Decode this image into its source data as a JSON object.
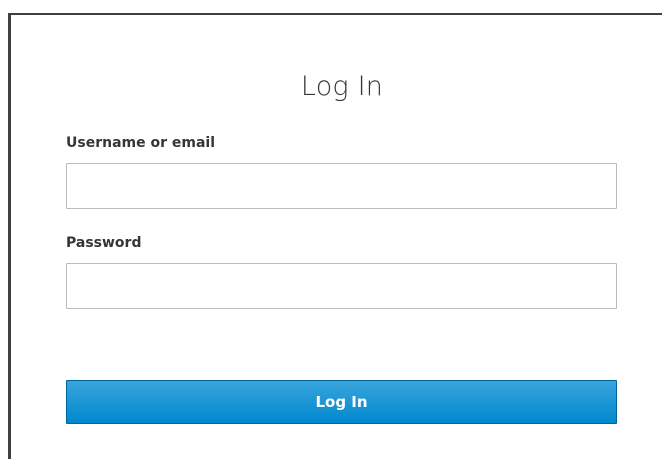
{
  "login": {
    "title": "Log In",
    "username_label": "Username or email",
    "username_value": "",
    "password_label": "Password",
    "password_value": "",
    "submit_label": "Log In"
  },
  "colors": {
    "button_top": "#39a5dc",
    "button_bottom": "#0088ce",
    "button_border": "#00659c",
    "text": "#363636",
    "input_border": "#bbbbbb"
  }
}
